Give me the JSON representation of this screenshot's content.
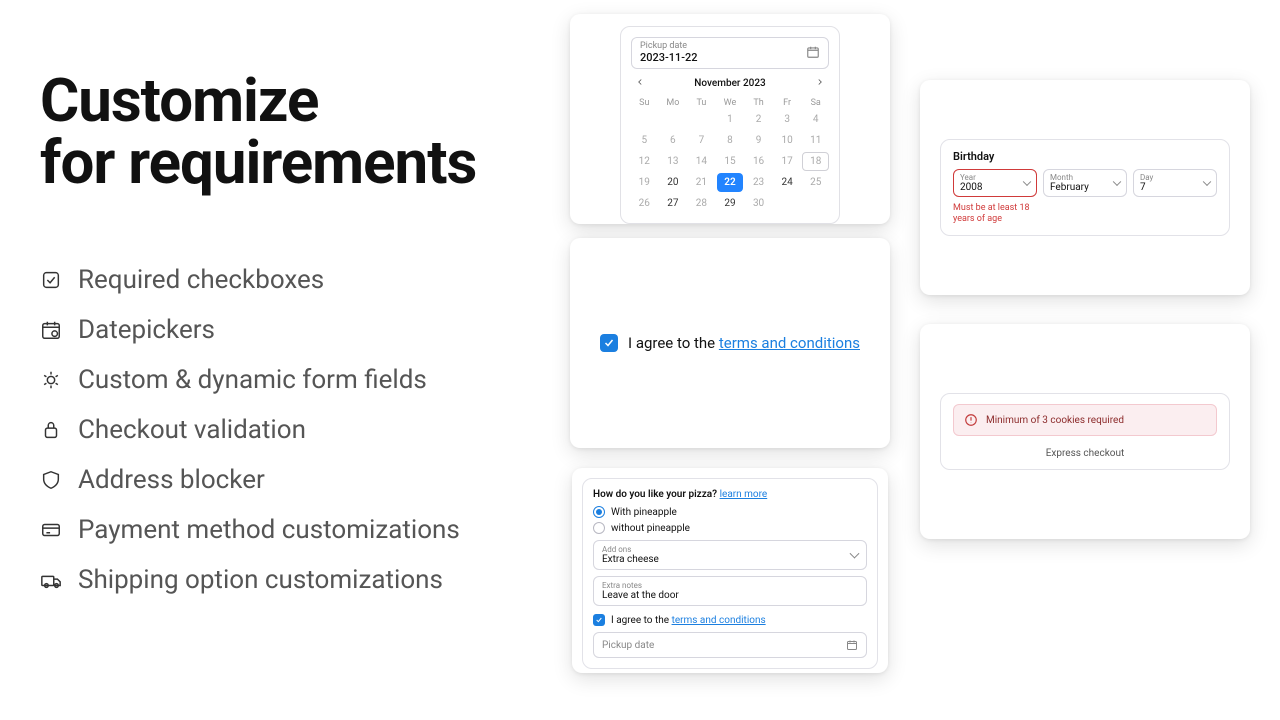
{
  "title_line1": "Customize",
  "title_line2": "for requirements",
  "features": [
    "Required checkboxes",
    "Datepickers",
    "Custom & dynamic form fields",
    "Checkout validation",
    "Address blocker",
    "Payment method customizations",
    "Shipping option customizations"
  ],
  "datepicker": {
    "field_label": "Pickup date",
    "field_value": "2023-11-22",
    "month_label": "November 2023",
    "dow": [
      "Su",
      "Mo",
      "Tu",
      "We",
      "Th",
      "Fr",
      "Sa"
    ],
    "days": [
      {
        "n": "",
        "en": false
      },
      {
        "n": "",
        "en": false
      },
      {
        "n": "",
        "en": false
      },
      {
        "n": "1",
        "en": false
      },
      {
        "n": "2",
        "en": false
      },
      {
        "n": "3",
        "en": false
      },
      {
        "n": "4",
        "en": false
      },
      {
        "n": "5",
        "en": false
      },
      {
        "n": "6",
        "en": false
      },
      {
        "n": "7",
        "en": false
      },
      {
        "n": "8",
        "en": false
      },
      {
        "n": "9",
        "en": false
      },
      {
        "n": "10",
        "en": false
      },
      {
        "n": "11",
        "en": false
      },
      {
        "n": "12",
        "en": false
      },
      {
        "n": "13",
        "en": false
      },
      {
        "n": "14",
        "en": false
      },
      {
        "n": "15",
        "en": false
      },
      {
        "n": "16",
        "en": false
      },
      {
        "n": "17",
        "en": false
      },
      {
        "n": "18",
        "en": false,
        "hov": true
      },
      {
        "n": "19",
        "en": false
      },
      {
        "n": "20",
        "en": true
      },
      {
        "n": "21",
        "en": false
      },
      {
        "n": "22",
        "en": true,
        "sel": true
      },
      {
        "n": "23",
        "en": false
      },
      {
        "n": "24",
        "en": true
      },
      {
        "n": "25",
        "en": false
      },
      {
        "n": "26",
        "en": false
      },
      {
        "n": "27",
        "en": true
      },
      {
        "n": "28",
        "en": false
      },
      {
        "n": "29",
        "en": true
      },
      {
        "n": "30",
        "en": false
      },
      {
        "n": "",
        "en": false
      },
      {
        "n": "",
        "en": false
      }
    ]
  },
  "terms": {
    "prefix": "I agree to the ",
    "link": "terms and conditions"
  },
  "pizza": {
    "question": "How do you like your pizza? ",
    "learn_more": "learn more",
    "opt1": "With pineapple",
    "opt2": "without pineapple",
    "addons_label": "Add ons",
    "addons_value": "Extra cheese",
    "notes_label": "Extra notes",
    "notes_value": "Leave at the door",
    "terms_prefix": "I agree to the ",
    "terms_link": "terms and conditions",
    "pickup_placeholder": "Pickup date"
  },
  "birthday": {
    "title": "Birthday",
    "year_label": "Year",
    "year_value": "2008",
    "month_label": "Month",
    "month_value": "February",
    "day_label": "Day",
    "day_value": "7",
    "error": "Must be at least 18 years of age"
  },
  "validation": {
    "alert": "Minimum of 3 cookies required",
    "express": "Express checkout"
  }
}
